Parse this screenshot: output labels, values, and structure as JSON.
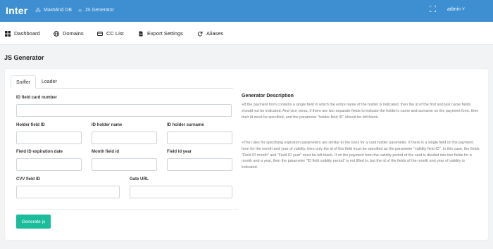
{
  "header": {
    "brand": "Inter",
    "breadcrumb": [
      {
        "icon": "database-icon",
        "label": "MaxMind DB"
      },
      {
        "icon": "code-icon",
        "label": "JS Generator"
      }
    ],
    "user": "admin ˅"
  },
  "nav": [
    {
      "icon": "dashboard-icon",
      "label": "Dashboard"
    },
    {
      "icon": "globe-icon",
      "label": "Domains"
    },
    {
      "icon": "credit-card-icon",
      "label": "CC List"
    },
    {
      "icon": "file-icon",
      "label": "Export Settings"
    },
    {
      "icon": "refresh-icon",
      "label": "Aliases"
    }
  ],
  "page": {
    "title": "JS Generator"
  },
  "tabs": [
    {
      "label": "Sniffer"
    },
    {
      "label": "Loader"
    }
  ],
  "form": {
    "id_card_number": {
      "label": "ID field card number",
      "value": "",
      "placeholder": ""
    },
    "holder_field_id": {
      "label": "Holder field ID",
      "value": ""
    },
    "id_holder_name": {
      "label": "ID holder name",
      "value": ""
    },
    "id_holder_surname": {
      "label": "ID holder surname",
      "value": ""
    },
    "field_id_expiration_date": {
      "label": "Field ID expiration date",
      "value": ""
    },
    "month_field_id": {
      "label": "Month field id",
      "value": ""
    },
    "field_id_year": {
      "label": "Field id year",
      "value": ""
    },
    "cvv_field_id": {
      "label": "CVV field ID",
      "value": ""
    },
    "gate_url": {
      "label": "Gate URL",
      "value": ""
    },
    "generate_label": "Generate js"
  },
  "description": {
    "title": "Generator Description",
    "paragraphs": [
      "If the payment form contains a single field in which the entire name of the holder is indicated, then the id of the first and last name fields should not be indicated. And vice versa, if there are two separate fields to indicate the holder's name and surname on the payment form, then their id must be specified, and the parameter \"holder field ID\" should be left blank.",
      "The rules for specifying expiration parameters are similar to the rules for a card holder parameter. If there is a single field on the payment form for the month and year of validity, then only the id of this field must be specified as the parameter \"validity field ID\". In this case, the fields \"Field ID month\" and \"Field ID year\" must be left blank. If on the payment form the validity period of the card is divided into two fields for a month and a year, then the parameter \"ID field validity period\" is not filled in, but the id of the fields of the month and year of validity is indicated."
    ]
  }
}
